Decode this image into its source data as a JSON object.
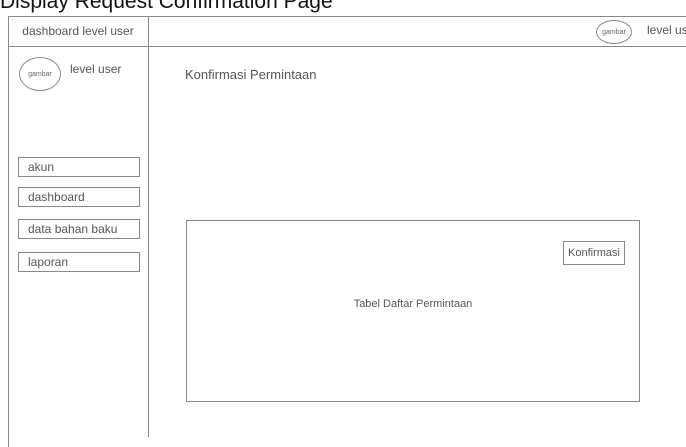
{
  "caption": "Display Request Confirmation Page",
  "header": {
    "brand": "dashboard level user",
    "avatar_text": "gambar",
    "user_label": "level us"
  },
  "sidebar": {
    "avatar_text": "gambar",
    "user_label": "level user",
    "items": [
      {
        "label": "akun"
      },
      {
        "label": "dashboard"
      },
      {
        "label": "data bahan baku"
      },
      {
        "label": "laporan"
      }
    ]
  },
  "main": {
    "title": "Konfirmasi Permintaan",
    "table_label": "Tabel Daftar Permintaan",
    "confirm_label": "Konfirmasi"
  }
}
